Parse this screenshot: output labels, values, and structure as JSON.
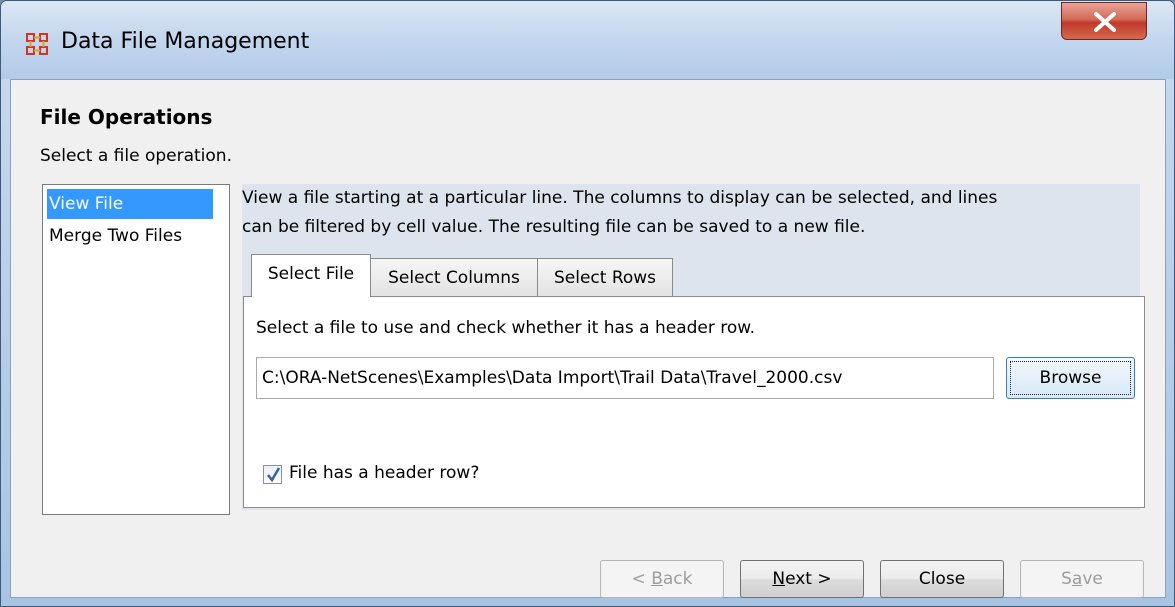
{
  "window": {
    "title": "Data File Management",
    "close_label": "X",
    "colors": {
      "titlebar": "#c3d6ee",
      "selection": "#3399ff",
      "close": "#c0392b"
    }
  },
  "header": {
    "title": "File Operations",
    "subtitle": "Select a file operation."
  },
  "operations": {
    "items": [
      {
        "label": "View File",
        "selected": true
      },
      {
        "label": "Merge Two Files",
        "selected": false
      }
    ]
  },
  "description": {
    "line1": "View a file starting at a particular line. The columns to display can be selected, and lines",
    "line2": "can be filtered by cell value. The resulting file can be saved to a new file."
  },
  "tabs": [
    {
      "label": "Select File",
      "active": true
    },
    {
      "label": "Select Columns",
      "active": false
    },
    {
      "label": "Select Rows",
      "active": false
    }
  ],
  "select_file": {
    "instruction": "Select a file to use and check whether it has a header row.",
    "file_path": "C:\\ORA-NetScenes\\Examples\\Data Import\\Trail Data\\Travel_2000.csv",
    "browse_label": "Browse",
    "header_row_label": "File has a header row?",
    "header_row_checked": true
  },
  "footer": {
    "back_pre": "< ",
    "back_mnemonic": "B",
    "back_rest": "ack",
    "next_mnemonic": "N",
    "next_rest": "ext >",
    "close_label": "Close",
    "save_pre": "S",
    "save_mnemonic": "a",
    "save_rest": "ve"
  }
}
